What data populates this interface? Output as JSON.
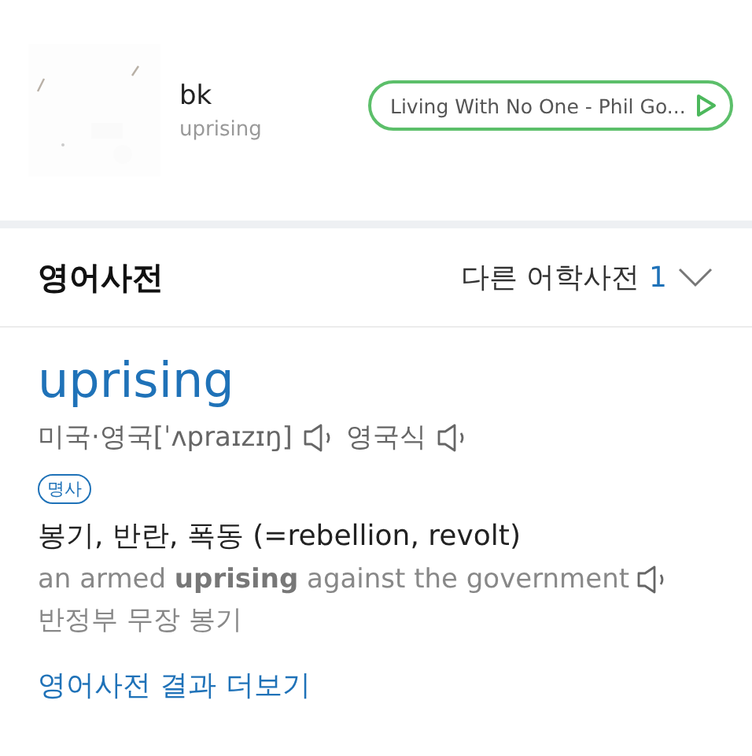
{
  "now_playing": {
    "kind": "picture",
    "artist": "bk",
    "track": "uprising",
    "song_button": "Living With No One - Phil Go..."
  },
  "dictionary_header": {
    "title": "영어사전",
    "other_dictionaries": "다른 어학사전",
    "other_count": "1",
    "expanded": false
  },
  "entry": {
    "word": "uprising",
    "pronunciation_label": "미국·영국",
    "pronunciation": "[ˈʌpraɪzɪŋ]",
    "british_label": "영국식",
    "part_of_speech": "명사",
    "meaning": "봉기, 반란, 폭동 (=rebellion, revolt)",
    "example": "an armed **uprising** against the government",
    "example_translation": "반정부 무장 봉기",
    "more_link": "영어사전 결과 더보기"
  }
}
